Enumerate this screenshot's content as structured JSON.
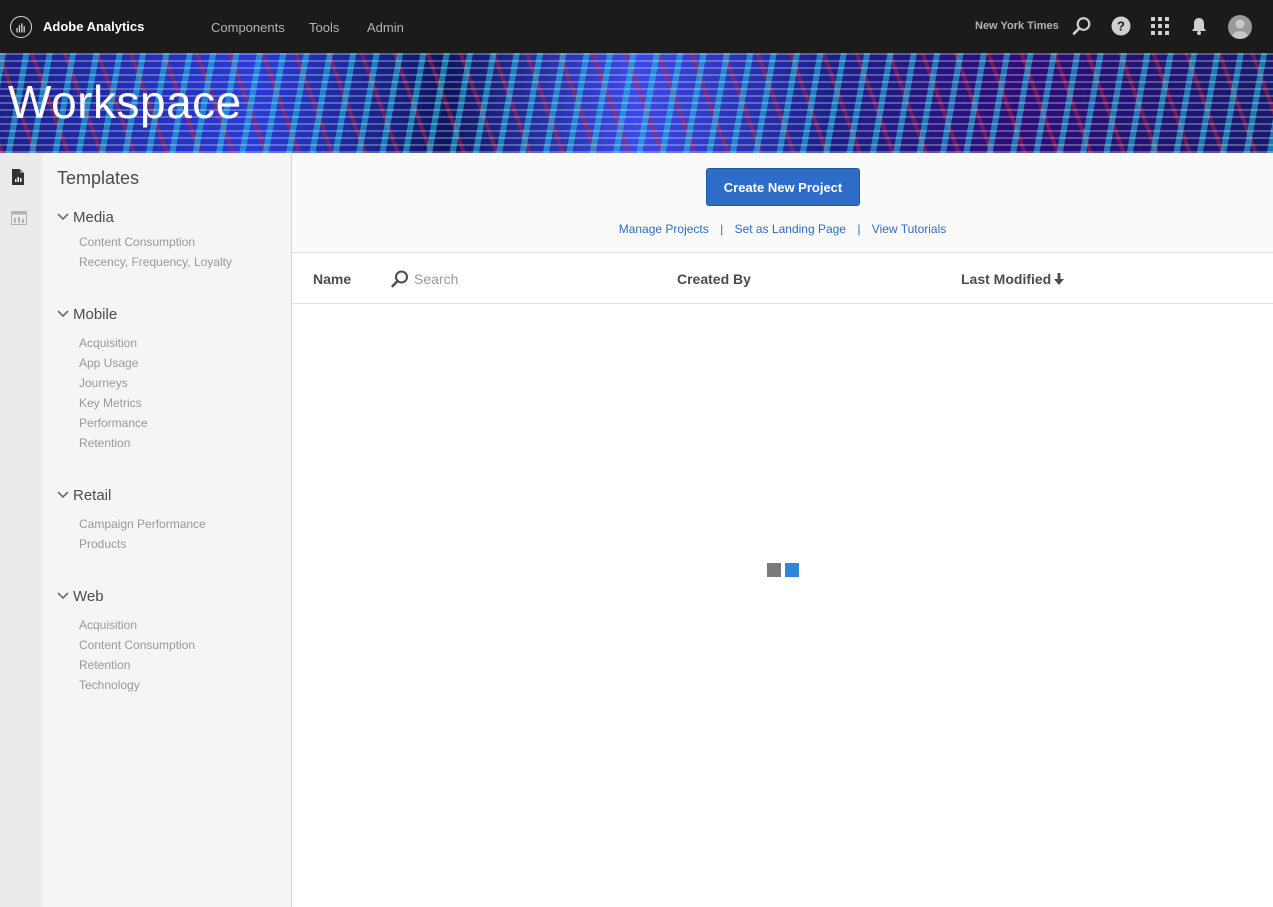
{
  "header": {
    "app_name": "Adobe Analytics",
    "nav": [
      "Components",
      "Tools",
      "Admin"
    ],
    "org_name": "New York Times",
    "icons": [
      "search-icon",
      "help-icon",
      "apps-grid-icon",
      "notifications-bell-icon",
      "user-avatar"
    ]
  },
  "banner": {
    "title": "Workspace"
  },
  "rail": {
    "icons": [
      "projects-document-icon",
      "panels-icon"
    ]
  },
  "templates": {
    "title": "Templates",
    "categories": [
      {
        "label": "Media",
        "items": [
          "Content Consumption",
          "Recency, Frequency, Loyalty"
        ]
      },
      {
        "label": "Mobile",
        "items": [
          "Acquisition",
          "App Usage",
          "Journeys",
          "Key Metrics",
          "Performance",
          "Retention"
        ]
      },
      {
        "label": "Retail",
        "items": [
          "Campaign Performance",
          "Products"
        ]
      },
      {
        "label": "Web",
        "items": [
          "Acquisition",
          "Content Consumption",
          "Retention",
          "Technology"
        ]
      }
    ]
  },
  "main": {
    "create_button": "Create New Project",
    "links": [
      "Manage Projects",
      "Set as Landing Page",
      "View Tutorials"
    ],
    "separator": "|",
    "table": {
      "name_header": "Name",
      "search_placeholder": "Search",
      "created_by_header": "Created By",
      "last_modified_header": "Last Modified"
    }
  },
  "colors": {
    "topbar": "#1b1b1b",
    "accent_blue": "#2d6dc8",
    "loader_gray": "#7a7a7a",
    "loader_blue": "#2d86d8"
  }
}
